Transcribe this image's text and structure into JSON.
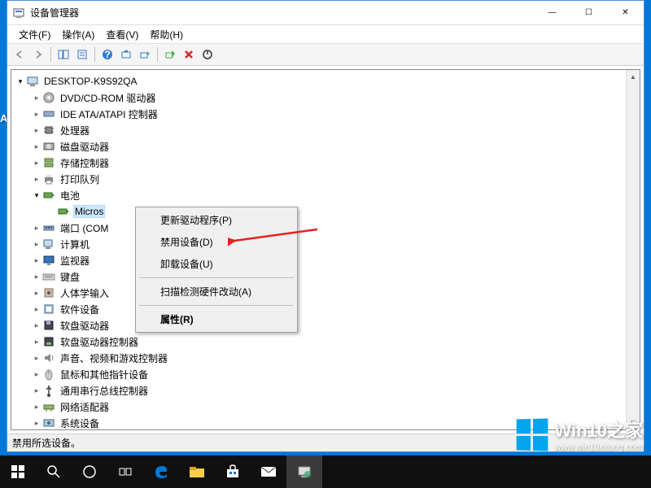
{
  "window": {
    "title": "设备管理器",
    "minimize": "—",
    "maximize": "☐",
    "close": "✕"
  },
  "menubar": {
    "file": "文件(F)",
    "action": "操作(A)",
    "view": "查看(V)",
    "help": "帮助(H)"
  },
  "tree": {
    "root": "DESKTOP-K9S92QA",
    "nodes": [
      {
        "label": "DVD/CD-ROM 驱动器",
        "icon": "disc"
      },
      {
        "label": "IDE ATA/ATAPI 控制器",
        "icon": "ide"
      },
      {
        "label": "处理器",
        "icon": "cpu"
      },
      {
        "label": "磁盘驱动器",
        "icon": "disk"
      },
      {
        "label": "存储控制器",
        "icon": "storage"
      },
      {
        "label": "打印队列",
        "icon": "printer"
      },
      {
        "label": "电池",
        "icon": "battery",
        "expanded": true,
        "children": [
          {
            "label": "Micros",
            "icon": "battery",
            "selected": true
          }
        ]
      },
      {
        "label": "端口 (COM",
        "icon": "port"
      },
      {
        "label": "计算机",
        "icon": "computer"
      },
      {
        "label": "监视器",
        "icon": "monitor"
      },
      {
        "label": "键盘",
        "icon": "keyboard"
      },
      {
        "label": "人体学输入",
        "icon": "hid"
      },
      {
        "label": "软件设备",
        "icon": "software"
      },
      {
        "label": "软盘驱动器",
        "icon": "floppy"
      },
      {
        "label": "软盘驱动器控制器",
        "icon": "floppyctl"
      },
      {
        "label": "声音、视频和游戏控制器",
        "icon": "sound"
      },
      {
        "label": "鼠标和其他指针设备",
        "icon": "mouse"
      },
      {
        "label": "通用串行总线控制器",
        "icon": "usb"
      },
      {
        "label": "网络适配器",
        "icon": "network"
      },
      {
        "label": "系统设备",
        "icon": "system"
      }
    ]
  },
  "context_menu": {
    "items": [
      {
        "label": "更新驱动程序(P)",
        "type": "item"
      },
      {
        "label": "禁用设备(D)",
        "type": "item"
      },
      {
        "label": "卸载设备(U)",
        "type": "item"
      },
      {
        "type": "sep"
      },
      {
        "label": "扫描检测硬件改动(A)",
        "type": "item"
      },
      {
        "type": "sep"
      },
      {
        "label": "属性(R)",
        "type": "item",
        "bold": true
      }
    ]
  },
  "statusbar": {
    "text": "禁用所选设备。"
  },
  "watermark": {
    "brand": "Win10之家",
    "url": "www.win10xitong.com"
  },
  "side_letter": "A"
}
